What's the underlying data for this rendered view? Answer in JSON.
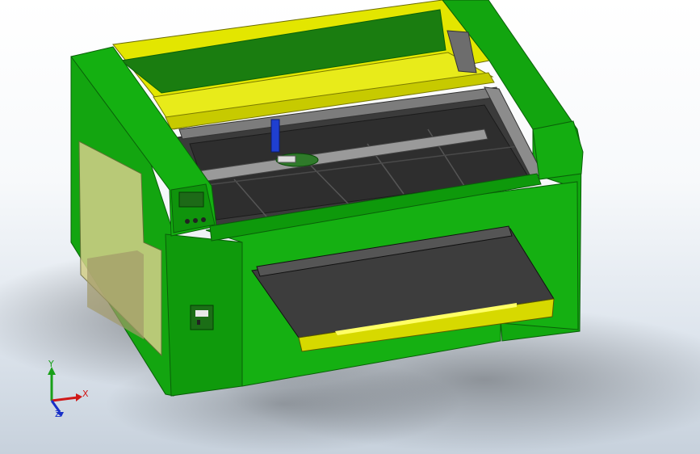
{
  "viewport": {
    "scene": "laser-cutter-machine-cad-model",
    "colors": {
      "frame": "#11a80f",
      "frame_dark": "#0a7a08",
      "rail": "#e3e600",
      "rail_dark": "#b9bb00",
      "bed": "#3a3a3a",
      "gantry": "#8a8a8a"
    }
  },
  "triad": {
    "x_label": "X",
    "y_label": "Y",
    "z_label": "Z",
    "x_color": "#d01818",
    "y_color": "#18a018",
    "z_color": "#1830c8"
  }
}
